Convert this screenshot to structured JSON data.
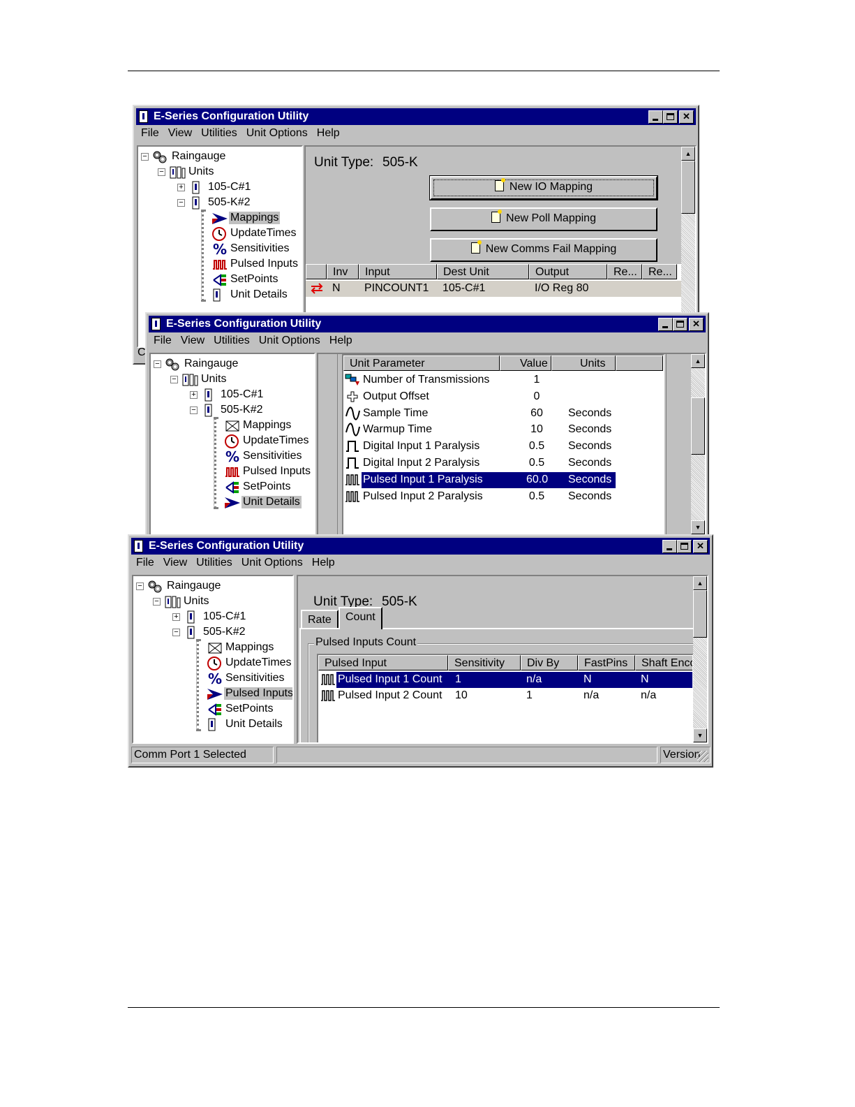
{
  "window1": {
    "title": "E-Series Configuration Utility",
    "menu": [
      "File",
      "View",
      "Utilities",
      "Unit Options",
      "Help"
    ],
    "tree": {
      "root": "Raingauge",
      "units": "Units",
      "unit1": "105-C#1",
      "unit2": "505-K#2",
      "children": [
        "Mappings",
        "UpdateTimes",
        "Sensitivities",
        "Pulsed Inputs",
        "SetPoints",
        "Unit Details"
      ],
      "selected": "Mappings"
    },
    "unit_type_label": "Unit Type:",
    "unit_type_value": "505-K",
    "buttons": {
      "new_io": "New IO Mapping",
      "new_poll": "New Poll Mapping",
      "new_comms_fail": "New Comms Fail Mapping"
    },
    "table": {
      "headers": [
        "Inv",
        "Input",
        "Dest Unit",
        "Output",
        "Re...",
        "Re..."
      ],
      "rows": [
        {
          "inv": "N",
          "input": "PINCOUNT1",
          "dest": "105-C#1",
          "output": "I/O Reg 80"
        }
      ]
    },
    "status_fragment": "C"
  },
  "window2": {
    "title": "E-Series Configuration Utility",
    "menu": [
      "File",
      "View",
      "Utilities",
      "Unit Options",
      "Help"
    ],
    "tree": {
      "root": "Raingauge",
      "units": "Units",
      "unit1": "105-C#1",
      "unit2": "505-K#2",
      "children": [
        "Mappings",
        "UpdateTimes",
        "Sensitivities",
        "Pulsed Inputs",
        "SetPoints",
        "Unit Details"
      ],
      "selected": "Unit Details"
    },
    "table": {
      "headers": [
        "Unit Parameter",
        "Value",
        "Units"
      ],
      "rows": [
        {
          "param": "Number of Transmissions",
          "value": "1",
          "units": "",
          "icon": "transmit-icon"
        },
        {
          "param": "Output Offset",
          "value": "0",
          "units": "",
          "icon": "plus-icon"
        },
        {
          "param": "Sample Time",
          "value": "60",
          "units": "Seconds",
          "icon": "wave-icon"
        },
        {
          "param": "Warmup Time",
          "value": "10",
          "units": "Seconds",
          "icon": "wave-icon"
        },
        {
          "param": "Digital Input 1 Paralysis",
          "value": "0.5",
          "units": "Seconds",
          "icon": "pulse-icon"
        },
        {
          "param": "Digital Input 2 Paralysis",
          "value": "0.5",
          "units": "Seconds",
          "icon": "pulse-icon"
        },
        {
          "param": "Pulsed Input 1 Paralysis",
          "value": "60.0",
          "units": "Seconds",
          "icon": "pulse-train-icon",
          "selected": true
        },
        {
          "param": "Pulsed Input 2 Paralysis",
          "value": "0.5",
          "units": "Seconds",
          "icon": "pulse-train-icon"
        }
      ]
    }
  },
  "window3": {
    "title": "E-Series Configuration Utility",
    "menu": [
      "File",
      "View",
      "Utilities",
      "Unit Options",
      "Help"
    ],
    "tree": {
      "root": "Raingauge",
      "units": "Units",
      "unit1": "105-C#1",
      "unit2": "505-K#2",
      "children": [
        "Mappings",
        "UpdateTimes",
        "Sensitivities",
        "Pulsed Inputs",
        "SetPoints",
        "Unit Details"
      ],
      "selected": "Pulsed Inputs"
    },
    "unit_type_label": "Unit Type:",
    "unit_type_value": "505-K",
    "tabs": [
      "Rate",
      "Count"
    ],
    "active_tab": "Count",
    "group_label": "Pulsed Inputs Count",
    "table": {
      "headers": [
        "Pulsed Input",
        "Sensitivity",
        "Div By",
        "FastPins",
        "Shaft Enco"
      ],
      "rows": [
        {
          "name": "Pulsed Input 1 Count",
          "sensitivity": "1",
          "div": "n/a",
          "fast": "N",
          "shaft": "N",
          "selected": true
        },
        {
          "name": "Pulsed Input 2 Count",
          "sensitivity": "10",
          "div": "1",
          "fast": "n/a",
          "shaft": "n/a"
        }
      ]
    },
    "status": {
      "left": "Comm Port 1 Selected",
      "right": "Version"
    }
  },
  "colors": {
    "titlebar": "#000080",
    "face": "#c0c0c0",
    "selection": "#000080"
  }
}
